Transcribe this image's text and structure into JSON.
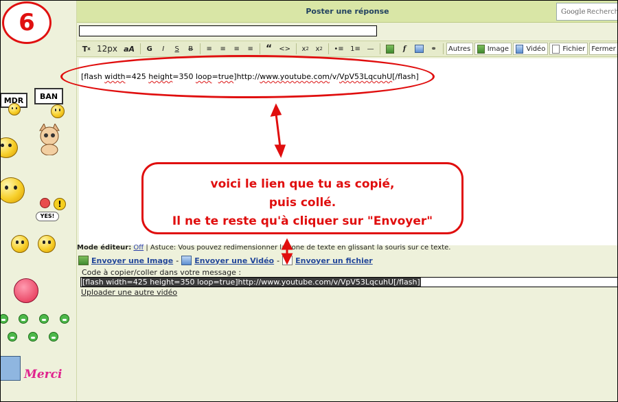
{
  "step_badge": "6",
  "header": {
    "title": "Poster une réponse",
    "search_brand": "Google",
    "search_placeholder": "Recherch"
  },
  "subject": {
    "value": ""
  },
  "toolbar": {
    "font_size": "12px",
    "font_aa": "aA",
    "bold": "G",
    "italic": "I",
    "underline": "S",
    "strike": "B",
    "autres": "Autres",
    "image": "Image",
    "video": "Vidéo",
    "fichier": "Fichier",
    "fermer": "Fermer"
  },
  "editor": {
    "line_parts": [
      "[flash ",
      "width",
      "=425 ",
      "height",
      "=350 ",
      "loop",
      "=",
      "true",
      "]http://",
      "www.youtube.com",
      "/v/",
      "VpV53LqcuhU",
      "[/flash]"
    ]
  },
  "callout": {
    "line1": "voici le lien que tu as copié,",
    "line2": "puis collé.",
    "line3": "Il ne te reste qu'à cliquer sur \"Envoyer\""
  },
  "mode": {
    "label": "Mode éditeur:",
    "value": "Off",
    "astuce": "| Astuce: Vous pouvez redimensionner la zone de texte en glissant la souris sur ce texte."
  },
  "send_links": {
    "image": "Envoyer une Image",
    "video": "Envoyer une Vidéo",
    "file": "Envoyer un fichier",
    "dash": "-"
  },
  "code": {
    "label": "Code à copier/coller dans votre message :",
    "value": "[flash width=425 height=350 loop=true]http://www.youtube.com/v/VpV53LqcuhU[/flash]"
  },
  "upload_again": "Uploader une autre vidéo",
  "smileys": {
    "mdr": "MDR",
    "ban": "BAN",
    "yes": "YES!",
    "merci": "Merci"
  },
  "colors": {
    "annotation_red": "#e00e0e",
    "header_green": "#d9e6a6",
    "panel": "#eef1db"
  }
}
